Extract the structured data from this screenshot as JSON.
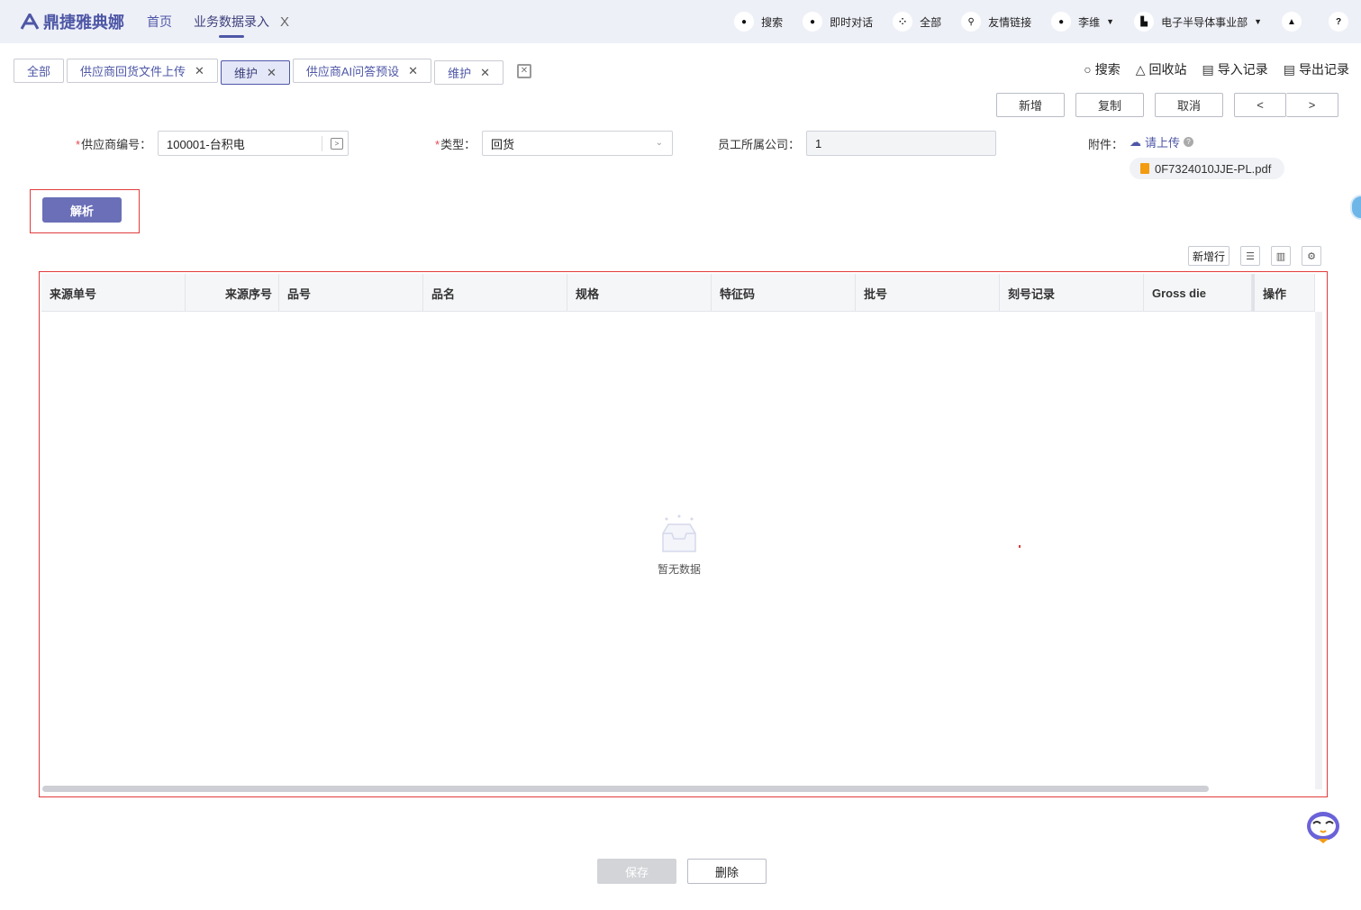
{
  "app": {
    "brand": "鼎捷雅典娜"
  },
  "nav": {
    "home": "首页",
    "active_tab": "业务数据录入",
    "close": "X"
  },
  "topbar": {
    "search": "搜索",
    "chat": "即时对话",
    "all": "全部",
    "links": "友情链接",
    "user": "李维",
    "org": "电子半导体事业部"
  },
  "tabs": [
    {
      "label": "全部"
    },
    {
      "label": "供应商回货文件上传"
    },
    {
      "label": "维护"
    },
    {
      "label": "供应商AI问答预设"
    },
    {
      "label": "维护"
    }
  ],
  "toolbar": {
    "search": "搜索",
    "recycle": "回收站",
    "import": "导入记录",
    "export": "导出记录"
  },
  "actions": {
    "add": "新增",
    "copy": "复制",
    "cancel": "取消",
    "prev": "<",
    "next": ">"
  },
  "form": {
    "supplier_label": "供应商编号：",
    "supplier_value": "100001-台积电",
    "type_label": "类型：",
    "type_value": "回货",
    "company_label": "员工所属公司：",
    "company_value": "1",
    "attachment_label": "附件：",
    "upload_label": "请上传",
    "file_name": "0F7324010JJE-PL.pdf",
    "required_mark": "*"
  },
  "parse_button": "解析",
  "grid": {
    "add_row": "新增行",
    "columns": [
      "来源单号",
      "来源序号",
      "品号",
      "品名",
      "规格",
      "特征码",
      "批号",
      "刻号记录",
      "Gross die",
      "操作"
    ],
    "empty_text": "暂无数据"
  },
  "bottom": {
    "save": "保存",
    "delete": "删除"
  },
  "colors": {
    "brand": "#4e57a6",
    "primary_button": "#6a6fb7",
    "highlight_border": "#e23b3b"
  }
}
